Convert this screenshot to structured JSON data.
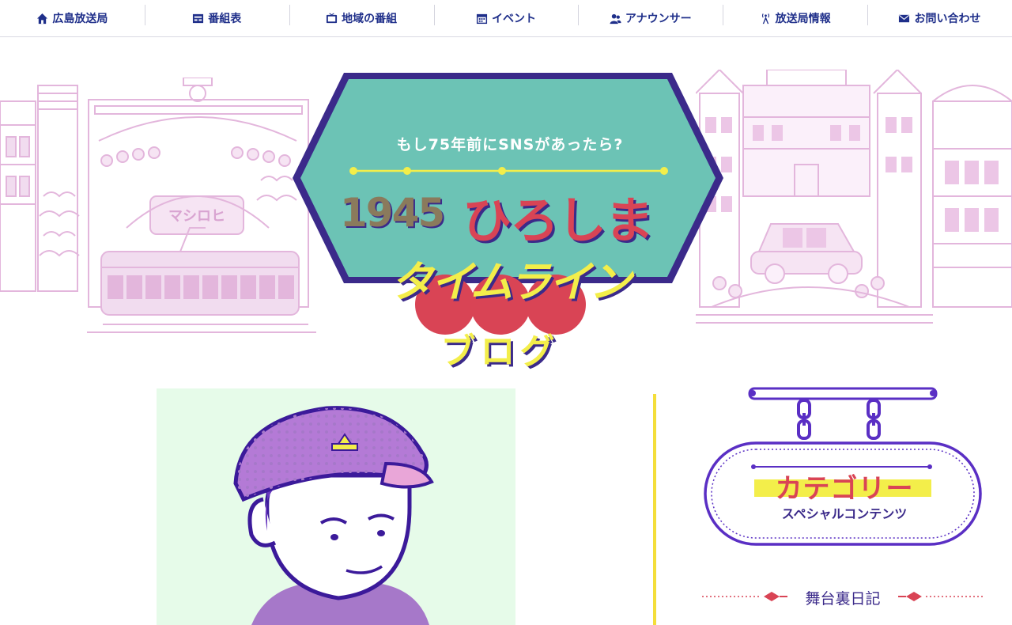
{
  "nav": {
    "items": [
      {
        "label": "広島放送局",
        "icon": "home-icon"
      },
      {
        "label": "番組表",
        "icon": "tv-schedule-icon"
      },
      {
        "label": "地域の番組",
        "icon": "tv-icon"
      },
      {
        "label": "イベント",
        "icon": "calendar-icon"
      },
      {
        "label": "アナウンサー",
        "icon": "people-icon"
      },
      {
        "label": "放送局情報",
        "icon": "antenna-icon"
      },
      {
        "label": "お問い合わせ",
        "icon": "mail-icon"
      }
    ]
  },
  "hero": {
    "tagline": "もし75年前にSNSがあったら?",
    "year": "1945",
    "title_main": "ひろしま",
    "title_sub": "タイムライン",
    "blog_label": "ブログ",
    "building_sign": "マシロヒ"
  },
  "sidebar": {
    "category_title": "カテゴリー",
    "category_subtitle": "スペシャルコンテンツ",
    "category_items": [
      "舞台裏日記"
    ]
  },
  "colors": {
    "nav_text": "#1f2f8a",
    "purple": "#3b2a8a",
    "teal": "#6cc3b5",
    "red": "#d94455",
    "yellow": "#f3ee4a",
    "pink_lines": "#e3b6dc",
    "mint_bg": "#e6fbe9"
  }
}
